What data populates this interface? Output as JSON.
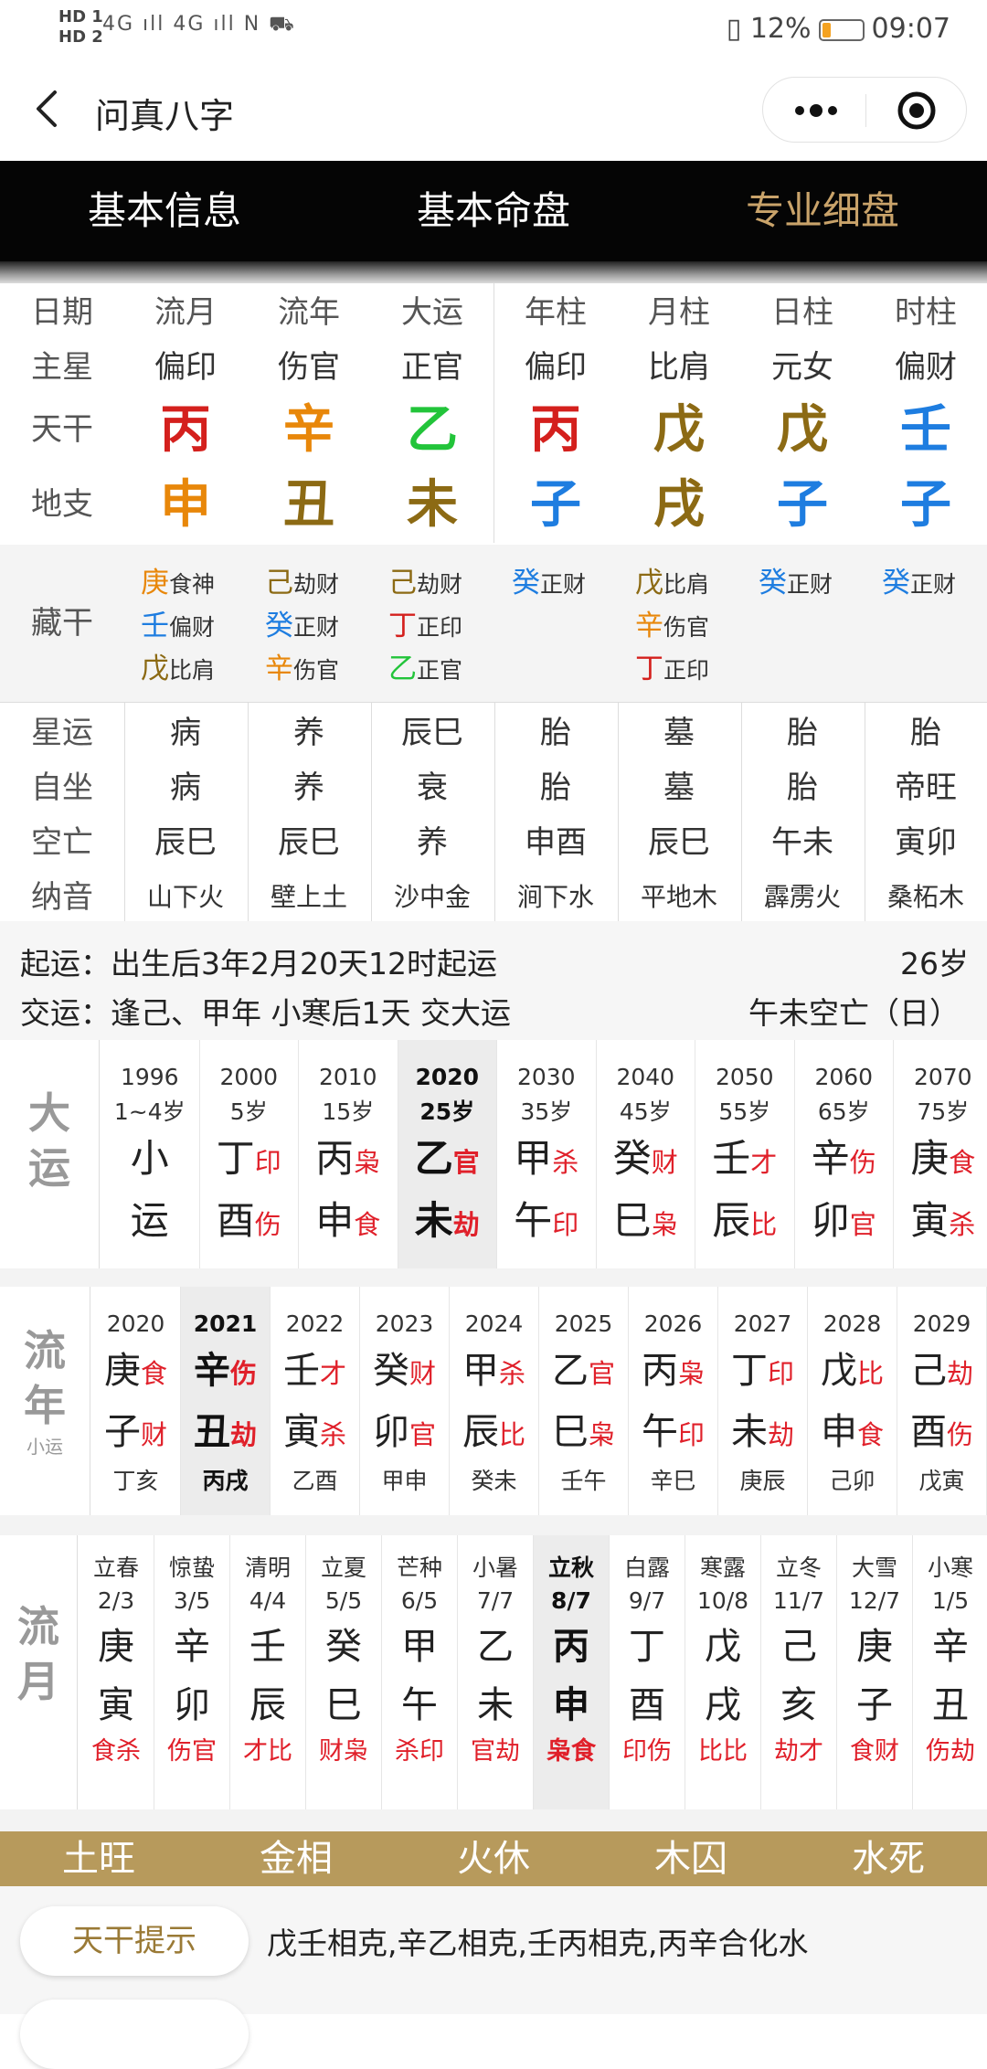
{
  "status_bar": {
    "left_top": "HD 1",
    "left_bottom": "HD 2",
    "signal": "4G ıll 4G ıll N ⛟",
    "battery": "12%",
    "time": "09:07"
  },
  "nav": {
    "title": "问真八字"
  },
  "tabs": [
    {
      "label": "基本信息",
      "active": false
    },
    {
      "label": "基本命盘",
      "active": false
    },
    {
      "label": "专业细盘",
      "active": true
    }
  ],
  "colors": {
    "fire": "#d4201d",
    "earth": "#8c6a14",
    "wood": "#22c43a",
    "water": "#1e7de0",
    "metal": "#e8870a",
    "gold": "#b79a5c"
  },
  "pillars": {
    "row_labels": [
      "日期",
      "主星",
      "天干",
      "地支"
    ],
    "columns": [
      {
        "header": "流月",
        "star": "偏印",
        "stem": "丙",
        "stem_el": "fire",
        "branch": "申",
        "branch_el": "metal"
      },
      {
        "header": "流年",
        "star": "伤官",
        "stem": "辛",
        "stem_el": "metal",
        "branch": "丑",
        "branch_el": "earth"
      },
      {
        "header": "大运",
        "star": "正官",
        "stem": "乙",
        "stem_el": "wood",
        "branch": "未",
        "branch_el": "earth"
      },
      {
        "header": "年柱",
        "star": "偏印",
        "stem": "丙",
        "stem_el": "fire",
        "branch": "子",
        "branch_el": "water"
      },
      {
        "header": "月柱",
        "star": "比肩",
        "stem": "戊",
        "stem_el": "earth",
        "branch": "戌",
        "branch_el": "earth"
      },
      {
        "header": "日柱",
        "star": "元女",
        "stem": "戊",
        "stem_el": "earth",
        "branch": "子",
        "branch_el": "water"
      },
      {
        "header": "时柱",
        "star": "偏财",
        "stem": "壬",
        "stem_el": "water",
        "branch": "子",
        "branch_el": "water"
      }
    ]
  },
  "canggan": {
    "label": "藏干",
    "columns": [
      [
        {
          "stem": "庚",
          "el": "metal",
          "god": "食神"
        },
        {
          "stem": "壬",
          "el": "water",
          "god": "偏财"
        },
        {
          "stem": "戊",
          "el": "earth",
          "god": "比肩"
        }
      ],
      [
        {
          "stem": "己",
          "el": "earth",
          "god": "劫财"
        },
        {
          "stem": "癸",
          "el": "water",
          "god": "正财"
        },
        {
          "stem": "辛",
          "el": "metal",
          "god": "伤官"
        }
      ],
      [
        {
          "stem": "己",
          "el": "earth",
          "god": "劫财"
        },
        {
          "stem": "丁",
          "el": "fire",
          "god": "正印"
        },
        {
          "stem": "乙",
          "el": "wood",
          "god": "正官"
        }
      ],
      [
        {
          "stem": "癸",
          "el": "water",
          "god": "正财"
        }
      ],
      [
        {
          "stem": "戊",
          "el": "earth",
          "god": "比肩"
        },
        {
          "stem": "辛",
          "el": "metal",
          "god": "伤官"
        },
        {
          "stem": "丁",
          "el": "fire",
          "god": "正印"
        }
      ],
      [
        {
          "stem": "癸",
          "el": "water",
          "god": "正财"
        }
      ],
      [
        {
          "stem": "癸",
          "el": "water",
          "god": "正财"
        }
      ]
    ]
  },
  "xingyun": {
    "rows": [
      {
        "label": "星运",
        "values": [
          "病",
          "养",
          "辰巳",
          "胎",
          "墓",
          "胎",
          "胎"
        ]
      },
      {
        "label": "自坐",
        "values": [
          "病",
          "养",
          "衰",
          "胎",
          "墓",
          "胎",
          "帝旺"
        ]
      },
      {
        "label": "空亡",
        "values": [
          "辰巳",
          "辰巳",
          "养",
          "申酉",
          "辰巳",
          "午未",
          "寅卯"
        ]
      },
      {
        "label": "纳音",
        "values": [
          "山下火",
          "壁上土",
          "沙中金",
          "涧下水",
          "平地木",
          "霹雳火",
          "桑柘木"
        ]
      }
    ]
  },
  "info": {
    "qiyun": "起运：出生后3年2月20天12时起运",
    "age": "26岁",
    "jiaoyun": "交运：逢己、甲年 小寒后1天 交大运",
    "kongwang": "午未空亡（日）"
  },
  "dayun": {
    "label": [
      "大",
      "运"
    ],
    "items": [
      {
        "year": "1996",
        "age": "1~4岁",
        "s1": "小",
        "g1": "",
        "s2": "运",
        "g2": "",
        "hl": false
      },
      {
        "year": "2000",
        "age": "5岁",
        "s1": "丁",
        "g1": "印",
        "s2": "酉",
        "g2": "伤",
        "hl": false
      },
      {
        "year": "2010",
        "age": "15岁",
        "s1": "丙",
        "g1": "枭",
        "s2": "申",
        "g2": "食",
        "hl": false
      },
      {
        "year": "2020",
        "age": "25岁",
        "s1": "乙",
        "g1": "官",
        "s2": "未",
        "g2": "劫",
        "hl": true
      },
      {
        "year": "2030",
        "age": "35岁",
        "s1": "甲",
        "g1": "杀",
        "s2": "午",
        "g2": "印",
        "hl": false
      },
      {
        "year": "2040",
        "age": "45岁",
        "s1": "癸",
        "g1": "财",
        "s2": "巳",
        "g2": "枭",
        "hl": false
      },
      {
        "year": "2050",
        "age": "55岁",
        "s1": "壬",
        "g1": "才",
        "s2": "辰",
        "g2": "比",
        "hl": false
      },
      {
        "year": "2060",
        "age": "65岁",
        "s1": "辛",
        "g1": "伤",
        "s2": "卯",
        "g2": "官",
        "hl": false
      },
      {
        "year": "2070",
        "age": "75岁",
        "s1": "庚",
        "g1": "食",
        "s2": "寅",
        "g2": "杀",
        "hl": false
      }
    ]
  },
  "liunian": {
    "label": [
      "流",
      "年"
    ],
    "sublabel": "小运",
    "items": [
      {
        "year": "2020",
        "s1": "庚",
        "g1": "食",
        "s2": "子",
        "g2": "财",
        "xy": "丁亥",
        "hl": false
      },
      {
        "year": "2021",
        "s1": "辛",
        "g1": "伤",
        "s2": "丑",
        "g2": "劫",
        "xy": "丙戌",
        "hl": true
      },
      {
        "year": "2022",
        "s1": "壬",
        "g1": "才",
        "s2": "寅",
        "g2": "杀",
        "xy": "乙酉",
        "hl": false
      },
      {
        "year": "2023",
        "s1": "癸",
        "g1": "财",
        "s2": "卯",
        "g2": "官",
        "xy": "甲申",
        "hl": false
      },
      {
        "year": "2024",
        "s1": "甲",
        "g1": "杀",
        "s2": "辰",
        "g2": "比",
        "xy": "癸未",
        "hl": false
      },
      {
        "year": "2025",
        "s1": "乙",
        "g1": "官",
        "s2": "巳",
        "g2": "枭",
        "xy": "壬午",
        "hl": false
      },
      {
        "year": "2026",
        "s1": "丙",
        "g1": "枭",
        "s2": "午",
        "g2": "印",
        "xy": "辛巳",
        "hl": false
      },
      {
        "year": "2027",
        "s1": "丁",
        "g1": "印",
        "s2": "未",
        "g2": "劫",
        "xy": "庚辰",
        "hl": false
      },
      {
        "year": "2028",
        "s1": "戊",
        "g1": "比",
        "s2": "申",
        "g2": "食",
        "xy": "己卯",
        "hl": false
      },
      {
        "year": "2029",
        "s1": "己",
        "g1": "劫",
        "s2": "酉",
        "g2": "伤",
        "xy": "戊寅",
        "hl": false
      }
    ]
  },
  "liuyue": {
    "label": [
      "流",
      "月"
    ],
    "items": [
      {
        "term": "立春",
        "date": "2/3",
        "s": "庚",
        "b": "寅",
        "gods": "食杀",
        "hl": false
      },
      {
        "term": "惊蛰",
        "date": "3/5",
        "s": "辛",
        "b": "卯",
        "gods": "伤官",
        "hl": false
      },
      {
        "term": "清明",
        "date": "4/4",
        "s": "壬",
        "b": "辰",
        "gods": "才比",
        "hl": false
      },
      {
        "term": "立夏",
        "date": "5/5",
        "s": "癸",
        "b": "巳",
        "gods": "财枭",
        "hl": false
      },
      {
        "term": "芒种",
        "date": "6/5",
        "s": "甲",
        "b": "午",
        "gods": "杀印",
        "hl": false
      },
      {
        "term": "小暑",
        "date": "7/7",
        "s": "乙",
        "b": "未",
        "gods": "官劫",
        "hl": false
      },
      {
        "term": "立秋",
        "date": "8/7",
        "s": "丙",
        "b": "申",
        "gods": "枭食",
        "hl": true
      },
      {
        "term": "白露",
        "date": "9/7",
        "s": "丁",
        "b": "酉",
        "gods": "印伤",
        "hl": false
      },
      {
        "term": "寒露",
        "date": "10/8",
        "s": "戊",
        "b": "戌",
        "gods": "比比",
        "hl": false
      },
      {
        "term": "立冬",
        "date": "11/7",
        "s": "己",
        "b": "亥",
        "gods": "劫才",
        "hl": false
      },
      {
        "term": "大雪",
        "date": "12/7",
        "s": "庚",
        "b": "子",
        "gods": "食财",
        "hl": false
      },
      {
        "term": "小寒",
        "date": "1/5",
        "s": "辛",
        "b": "丑",
        "gods": "伤劫",
        "hl": false
      }
    ]
  },
  "wuxing": [
    "土旺",
    "金相",
    "火休",
    "木囚",
    "水死"
  ],
  "tips": {
    "button": "天干提示",
    "text": "戊壬相克,辛乙相克,壬丙相克,丙辛合化水"
  }
}
